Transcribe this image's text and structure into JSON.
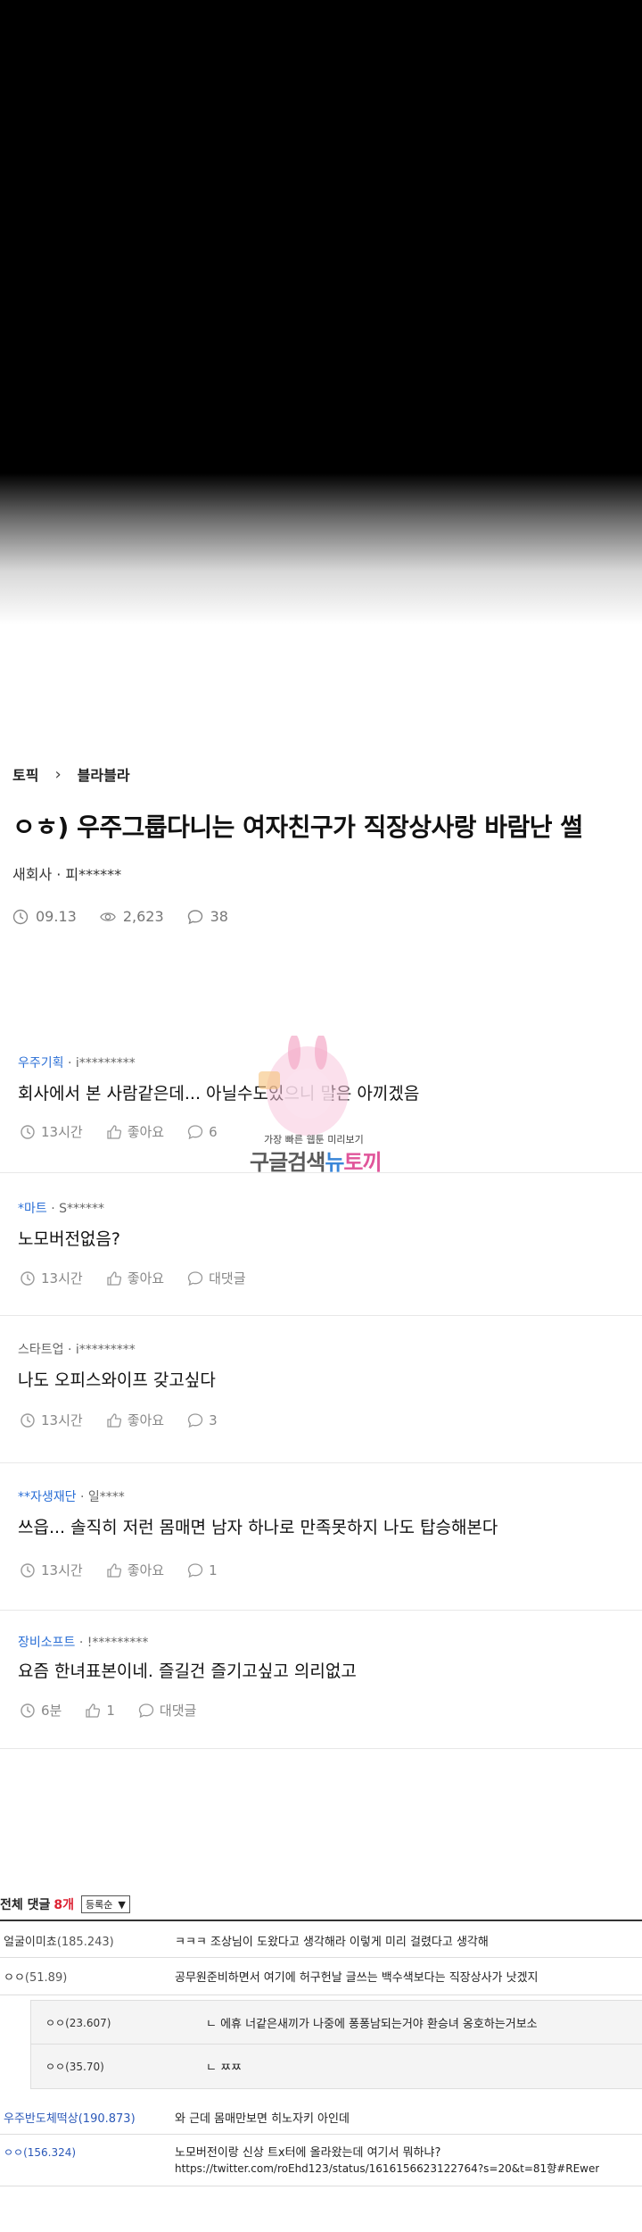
{
  "breadcrumb": {
    "topic": "토픽",
    "sub": "블라블라"
  },
  "post": {
    "title": "ㅇㅎ) 우주그룹다니는 여자친구가 직장상사랑 바람난 썰",
    "author": "새회사 · 피******",
    "date": "09.13",
    "views": "2,623",
    "comments": "38"
  },
  "watermark": {
    "small": "가장 빠른 웹툰 미리보기",
    "main_a": "구글검색",
    "main_b": "뉴",
    "main_c": "토끼"
  },
  "comments": [
    {
      "company": "우주기획",
      "user": " · i*********",
      "body": "회사에서 본 사람같은데... 아닐수도있으니 말은 아끼겠음",
      "time": "13시간",
      "like": "좋아요",
      "reply": "6"
    },
    {
      "company": "*마트",
      "user": " · S******",
      "body": "노모버전없음?",
      "time": "13시간",
      "like": "좋아요",
      "reply": "대댓글"
    },
    {
      "company": "",
      "user": "스타트업 · i*********",
      "body": "나도 오피스와이프 갖고싶다",
      "time": "13시간",
      "like": "좋아요",
      "reply": "3"
    },
    {
      "company": "**자생재단",
      "user": " · 일****",
      "body": "쓰읍... 솔직히 저런 몸매면 남자 하나로 만족못하지 나도 탑승해본다",
      "time": "13시간",
      "like": "좋아요",
      "reply": "1"
    },
    {
      "company": "장비소프트",
      "user": " · !*********",
      "body": "요즘 한녀표본이네. 즐길건 즐기고싶고 의리없고",
      "time": "6분",
      "like": "1",
      "reply": "대댓글"
    }
  ],
  "board": {
    "label": "전체 댓글",
    "count": "8개",
    "sort": "등록순",
    "rows": [
      {
        "nick": "얼굴이미쵸",
        "score": "(185.243)",
        "text": "ㅋㅋㅋ 조상님이 도왔다고 생각해라 이렇게 미리 걸렸다고 생각해"
      },
      {
        "nick": "ㅇㅇ",
        "score": "(51.89)",
        "text": "공무원준비하면서 여기에 허구헌날 글쓰는 백수색보다는 직장상사가 낫겠지"
      },
      {
        "nick": "ㅇㅇ",
        "score": "(23.607)",
        "text": "ㄴ 에휴 너같은새끼가 나중에 퐁퐁남되는거야 환승녀 옹호하는거보소"
      },
      {
        "nick": "ㅇㅇ",
        "score": "(35.70)",
        "text": "ㄴ ㅉㅉ"
      },
      {
        "nick": "우주반도체떡상",
        "score": "(190.873)",
        "text": "와 근데 몸매만보면 히노자키 아인데"
      },
      {
        "nick": "ㅇㅇ",
        "score": "(156.324)",
        "text": "노모버전이랑 신상 트x터에 올라왔는데 여기서 뭐하냐?",
        "link": "https://twitter.com/roEhd123/status/1616156623122764?s=20&t=81향#REwer"
      }
    ]
  }
}
